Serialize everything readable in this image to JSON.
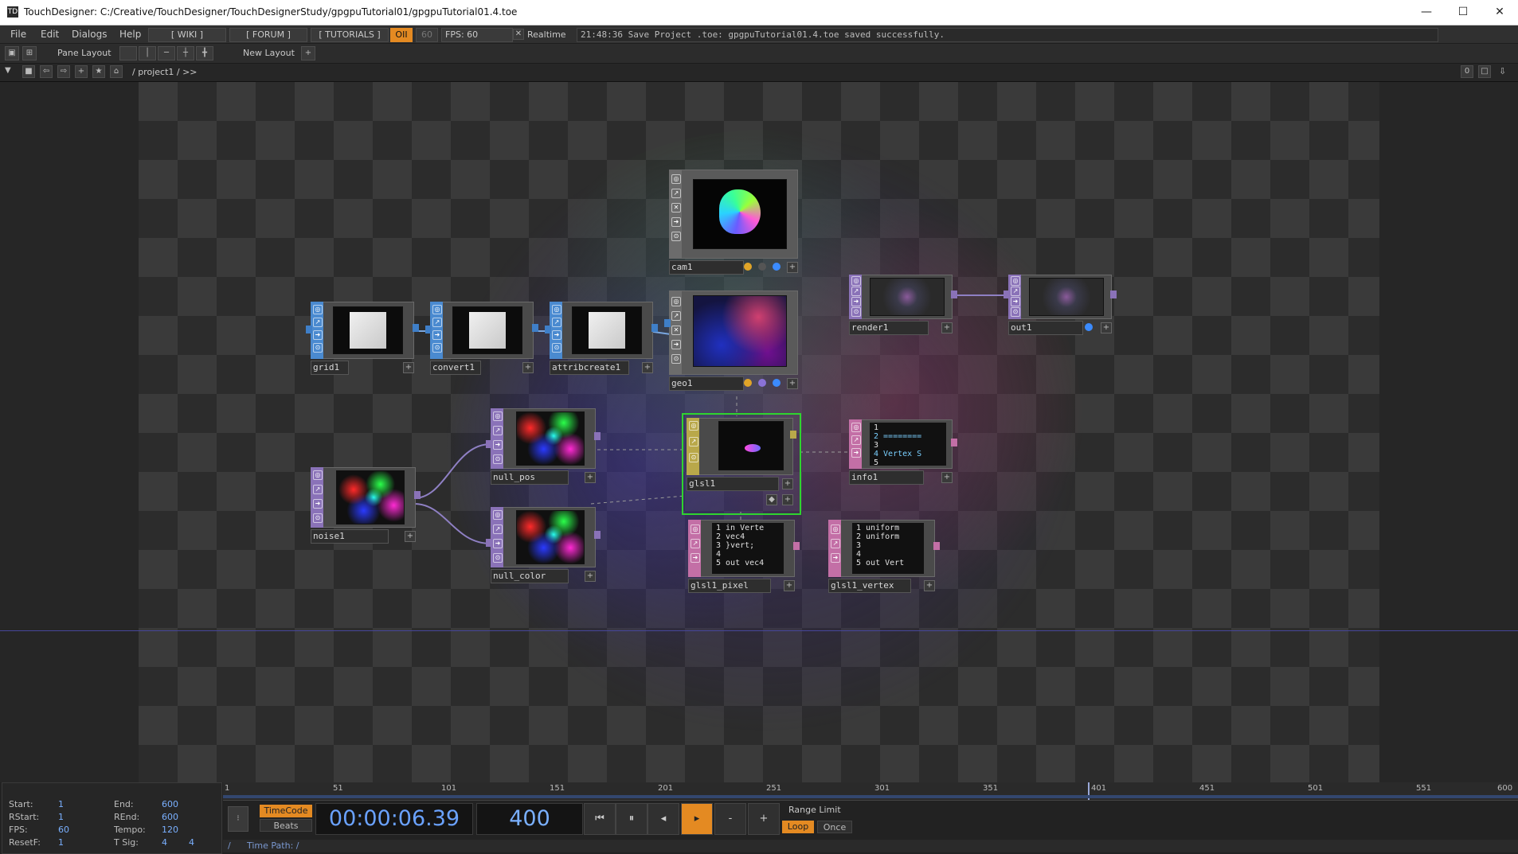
{
  "window": {
    "title": "TouchDesigner: C:/Creative/TouchDesigner/TouchDesignerStudy/gpgpuTutorial01/gpgpuTutorial01.4.toe",
    "minimize": "—",
    "maximize": "☐",
    "close": "✕"
  },
  "menu": {
    "items": [
      "File",
      "Edit",
      "Dialogs",
      "Help"
    ],
    "wiki": "[ WIKI ]",
    "forum": "[ FORUM ]",
    "tutorials": "[ TUTORIALS ]",
    "oii": "OII",
    "fps_cap": "60",
    "fps": "FPS:  60",
    "realtime": "Realtime",
    "status": "21:48:36 Save Project .toe: gpgpuTutorial01.4.toe saved successfully."
  },
  "layout": {
    "pane_layout": "Pane Layout",
    "new_layout": "New Layout",
    "plus": "+"
  },
  "pathbar": {
    "path": "/ project1 / >>",
    "counter": "0"
  },
  "nodes": {
    "cam1": "cam1",
    "grid1": "grid1",
    "convert1": "convert1",
    "attribcreate1": "attribcreate1",
    "geo1": "geo1",
    "render1": "render1",
    "out1": "out1",
    "null_pos": "null_pos",
    "noise1": "noise1",
    "null_color": "null_color",
    "glsl1": "glsl1",
    "info1": "info1",
    "glsl1_pixel": "glsl1_pixel",
    "glsl1_vertex": "glsl1_vertex"
  },
  "code": {
    "info1": {
      "lines": [
        "1",
        "2  ========",
        "3",
        "4  Vertex S",
        "5"
      ]
    },
    "glsl1_pixel": {
      "lines": [
        "1  in Verte",
        "2       vec4",
        "3  }vert;",
        "4",
        "5  out vec4"
      ]
    },
    "glsl1_vertex": {
      "lines": [
        "1  uniform",
        "2  uniform",
        "3",
        "4",
        "5  out Vert"
      ]
    }
  },
  "timeline": {
    "start_label": "Start:",
    "start": "1",
    "end_label": "End:",
    "end": "600",
    "rstart_label": "RStart:",
    "rstart": "1",
    "rend_label": "REnd:",
    "rend": "600",
    "fps_label": "FPS:",
    "fps": "60",
    "tempo_label": "Tempo:",
    "tempo": "120",
    "resetf_label": "ResetF:",
    "resetf": "1",
    "tsig_label": "T Sig:",
    "tsig_a": "4",
    "tsig_b": "4",
    "ticks": [
      "1",
      "51",
      "101",
      "151",
      "201",
      "251",
      "301",
      "351",
      "401",
      "451",
      "501",
      "551",
      "600"
    ],
    "timecode_btn": "TimeCode",
    "beats_btn": "Beats",
    "timecode": "00:00:06.39",
    "frame": "400",
    "range_limit": "Range Limit",
    "loop": "Loop",
    "once": "Once",
    "time_path": "Time Path: /",
    "slash": "/",
    "btn_rewind": "⏮",
    "btn_pause": "⏸",
    "btn_back": "◂",
    "btn_play": "▸",
    "btn_minus": "-",
    "btn_plus": "+"
  },
  "colors": {
    "accent": "#e48a22",
    "sop_blue": "#3f7fc8",
    "top_purple": "#8a72b8",
    "mat_yellow": "#b9a84a",
    "dat_pink": "#c36fa6",
    "selected": "#2fd42f"
  }
}
